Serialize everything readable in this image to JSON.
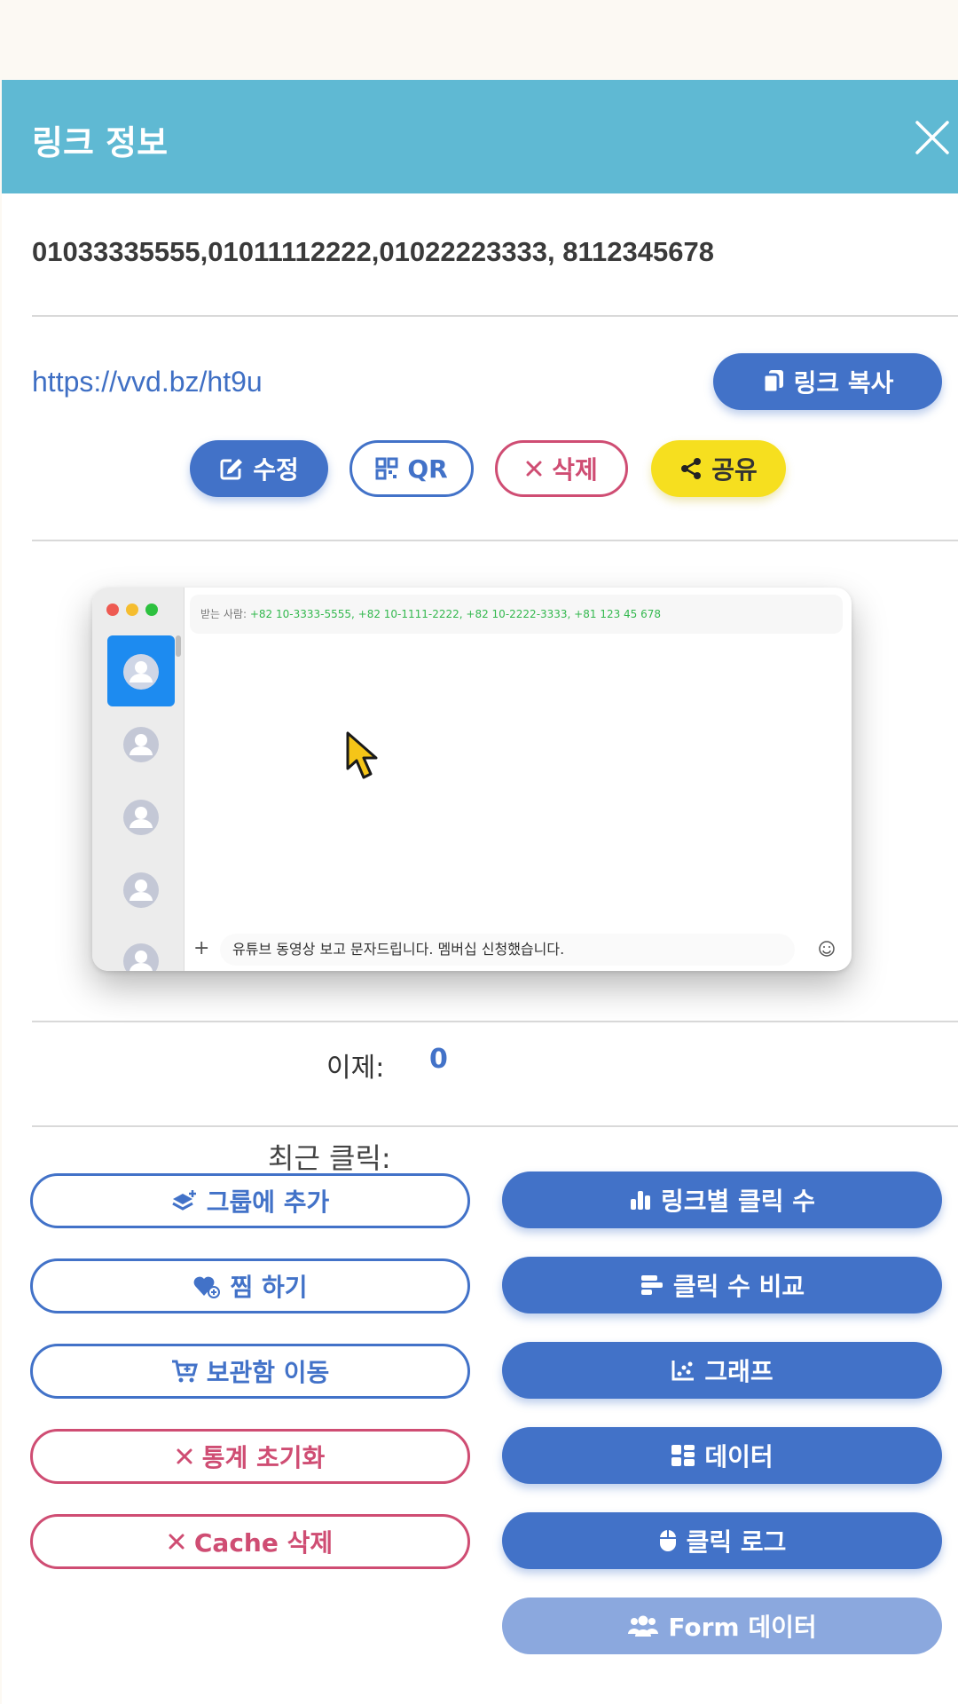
{
  "modal": {
    "title": "링크 정보",
    "recipients": "01033335555,01011112222,01022223333, 8112345678",
    "url": "https://vvd.bz/ht9u"
  },
  "actions": {
    "copy_link": "링크 복사",
    "edit": "수정",
    "qr": "QR",
    "delete": "삭제",
    "share": "공유"
  },
  "preview": {
    "to_label": "받는 사람:",
    "to_numbers": "+82 10-3333-5555, +82 10-1111-2222, +82 10-2222-3333, +81 123 45 678",
    "message": "유튜브 동영상 보고 문자드립니다. 멤버십 신청했습니다.",
    "plus": "+"
  },
  "stats": {
    "obscured_label": "이제:",
    "obscured_value": "0",
    "recent_click_label": "최근 클릭:"
  },
  "left_buttons": [
    "그룹에 추가",
    "찜 하기",
    "보관함 이동",
    "통계 초기화",
    "Cache 삭제"
  ],
  "right_buttons": [
    "링크별 클릭 수",
    "클릭 수 비교",
    "그래프",
    "데이터",
    "클릭 로그",
    "Form 데이터"
  ],
  "colors": {
    "header": "#5fb9d3",
    "primary": "#4272c8",
    "danger": "#cf4d73",
    "share": "#f6df1f",
    "link": "#3f6fc4"
  }
}
